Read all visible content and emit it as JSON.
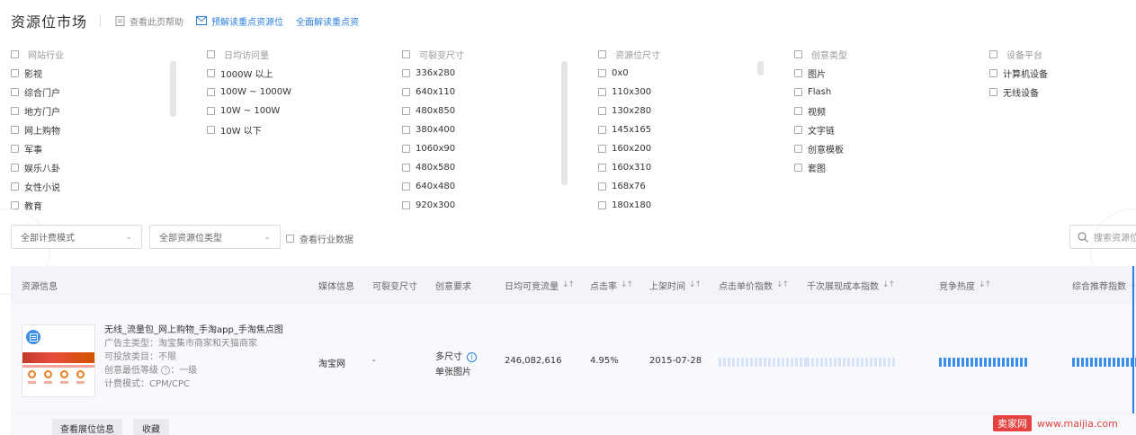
{
  "header": {
    "title": "资源位市场",
    "help_link": "查看此页帮助",
    "premium_link": "预解读重点资源位",
    "full_link": "全面解读重点资"
  },
  "filters": {
    "industry": {
      "title": "网站行业",
      "items": [
        "影视",
        "综合门户",
        "地方门户",
        "网上购物",
        "军事",
        "娱乐八卦",
        "女性小说",
        "教育"
      ]
    },
    "traffic": {
      "title": "日均访问量",
      "items": [
        "1000W 以上",
        "100W ~ 1000W",
        "10W ~ 100W",
        "10W 以下"
      ]
    },
    "crack_size": {
      "title": "可裂变尺寸",
      "items": [
        "336x280",
        "640x110",
        "480x850",
        "380x400",
        "1060x90",
        "480x580",
        "640x480",
        "920x300"
      ]
    },
    "slot_size": {
      "title": "资源位尺寸",
      "items": [
        "0x0",
        "110x300",
        "130x280",
        "145x165",
        "160x200",
        "160x310",
        "168x76",
        "180x180"
      ]
    },
    "creative_type": {
      "title": "创意类型",
      "items": [
        "图片",
        "Flash",
        "视频",
        "文字链",
        "创意模板",
        "套图"
      ]
    },
    "platform": {
      "title": "设备平台",
      "items": [
        "计算机设备",
        "无线设备"
      ]
    }
  },
  "controls": {
    "billing_select": "全部计费模式",
    "type_select": "全部资源位类型",
    "industry_data_check": "查看行业数据",
    "search_placeholder": "搜索资源位"
  },
  "table": {
    "headers": {
      "info": "资源信息",
      "media": "媒体信息",
      "crack": "可裂变尺寸",
      "creative": "创意要求",
      "traffic": "日均可竞流量",
      "ctr": "点击率",
      "online": "上架时间",
      "cpc_index": "点击单价指数",
      "cpm_index": "千次展现成本指数",
      "heat": "竞争热度",
      "overall": "综合推荐指数"
    },
    "row": {
      "name": "无线_流量包_网上购物_手淘app_手淘焦点图",
      "advertiser": "广告主类型：淘宝集市商家和天猫商家",
      "category": "可投放类目：不限",
      "creative_level_label": "创意最低等级",
      "creative_level_value": "：一级",
      "billing": "计费模式：CPM/CPC",
      "media": "淘宝网",
      "crack": "-",
      "creative_req_1": "多尺寸",
      "creative_req_2": "单张图片",
      "traffic": "246,082,616",
      "ctr": "4.95%",
      "online": "2015-07-28",
      "cpc_index_level": 0,
      "cpm_index_level": 0,
      "heat_level": 1,
      "overall_level": 1
    },
    "buttons": {
      "view_info": "查看展位信息",
      "collect": "收藏"
    }
  },
  "watermark": {
    "logo": "卖家网",
    "url": "www.maijia.com"
  },
  "colors": {
    "accent": "#2d7fe0",
    "watermark": "#e64340"
  }
}
